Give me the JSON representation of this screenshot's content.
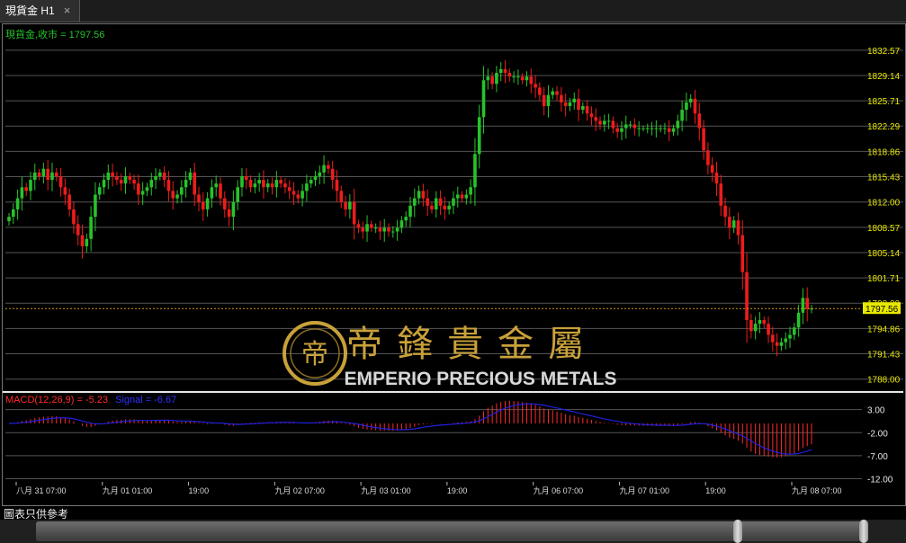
{
  "window": {
    "tab_title": "現貨金 H1",
    "close_glyph": "×"
  },
  "footer": {
    "note": "圖表只供參考"
  },
  "brand": {
    "chinese": "帝鋒貴金屬",
    "english": "EMPERIO PRECIOUS METALS",
    "logo_glyph": "帝"
  },
  "colors": {
    "up": "#27c32b",
    "down": "#ee1c1c",
    "grid": "#555555",
    "price_axis_text": "#e8e800",
    "current_price_line": "#d49a1a",
    "macd_hist": "#ff2a2a",
    "signal": "#2020e0",
    "gold": "#c9a13a"
  },
  "chart_data": [
    {
      "type": "candlestick",
      "label": "現貨金,收市 = 1797.56",
      "current_price": 1797.56,
      "current_price_label": "1797.56",
      "ylim": [
        1786.5,
        1834.5
      ],
      "y_ticks": [
        1832.57,
        1829.14,
        1825.71,
        1822.29,
        1818.86,
        1815.43,
        1812.0,
        1808.57,
        1805.14,
        1801.71,
        1798.29,
        1794.86,
        1791.43,
        1788.0
      ],
      "y_tick_labels": [
        "1832.57",
        "1829.14",
        "1825.71",
        "1822.29",
        "1818.86",
        "1815.43",
        "1812.00",
        "1808.57",
        "1805.14",
        "1801.71",
        "1798.29",
        "1794.86",
        "1791.43",
        "1788.00"
      ],
      "x_tick_labels": [
        "八月 31 07:00",
        "九月 01 01:00",
        "19:00",
        "九月 02 07:00",
        "九月 03 01:00",
        "19:00",
        "九月 06 07:00",
        "九月 07 01:00",
        "19:00",
        "九月 08 07:00"
      ],
      "close": [
        1810.0,
        1811.0,
        1812.5,
        1814.0,
        1813.5,
        1815.0,
        1816.0,
        1815.5,
        1816.5,
        1815.0,
        1816.0,
        1815.5,
        1814.0,
        1813.0,
        1811.0,
        1809.0,
        1807.5,
        1806.0,
        1807.0,
        1810.0,
        1813.0,
        1814.0,
        1815.0,
        1816.0,
        1815.5,
        1815.0,
        1814.5,
        1815.5,
        1815.0,
        1814.5,
        1813.0,
        1813.5,
        1814.0,
        1815.0,
        1815.5,
        1816.0,
        1815.0,
        1813.5,
        1812.5,
        1813.0,
        1814.0,
        1815.0,
        1816.0,
        1813.0,
        1812.0,
        1811.0,
        1812.5,
        1814.0,
        1814.5,
        1812.5,
        1811.0,
        1810.0,
        1812.0,
        1814.0,
        1815.5,
        1815.0,
        1814.0,
        1814.5,
        1815.0,
        1814.0,
        1814.5,
        1814.0,
        1815.0,
        1814.5,
        1814.0,
        1813.5,
        1813.0,
        1812.5,
        1813.5,
        1814.5,
        1815.0,
        1815.5,
        1816.0,
        1817.0,
        1816.5,
        1815.0,
        1813.5,
        1812.0,
        1811.0,
        1812.0,
        1809.0,
        1808.5,
        1808.0,
        1809.0,
        1808.5,
        1808.5,
        1808.0,
        1808.5,
        1808.0,
        1808.0,
        1808.5,
        1809.5,
        1810.0,
        1811.5,
        1812.5,
        1813.5,
        1812.5,
        1811.5,
        1811.0,
        1812.5,
        1811.5,
        1811.0,
        1811.5,
        1812.5,
        1813.0,
        1812.5,
        1813.0,
        1814.0,
        1818.5,
        1823.5,
        1828.5,
        1829.0,
        1828.0,
        1829.5,
        1830.0,
        1829.5,
        1829.0,
        1829.0,
        1829.0,
        1828.5,
        1829.0,
        1828.0,
        1827.5,
        1826.5,
        1825.0,
        1826.5,
        1827.0,
        1826.5,
        1825.5,
        1825.0,
        1825.5,
        1826.0,
        1824.5,
        1825.0,
        1824.0,
        1823.5,
        1823.0,
        1822.5,
        1823.0,
        1823.0,
        1822.0,
        1821.5,
        1822.0,
        1822.5,
        1822.5,
        1822.0,
        1822.0,
        1822.0,
        1822.0,
        1822.0,
        1822.0,
        1822.0,
        1822.0,
        1821.5,
        1822.0,
        1823.0,
        1824.5,
        1825.5,
        1826.0,
        1824.0,
        1822.0,
        1819.0,
        1817.0,
        1816.0,
        1814.5,
        1811.5,
        1810.0,
        1808.5,
        1809.5,
        1807.5,
        1802.5,
        1796.0,
        1794.5,
        1795.5,
        1796.0,
        1795.5,
        1794.0,
        1793.0,
        1792.5,
        1793.0,
        1793.5,
        1794.0,
        1795.0,
        1797.0,
        1799.0,
        1797.5,
        1797.56
      ]
    },
    {
      "type": "macd",
      "label": "MACD(12,26,9) = -5.23",
      "signal_label": "Signal = -6.67",
      "macd_value": -5.23,
      "signal_value": -6.67,
      "ylim": [
        -12.5,
        4.5
      ],
      "y_tick_labels": [
        "3.00",
        "-2.00",
        "-7.00",
        "-12.00"
      ],
      "y_ticks": [
        3.0,
        -2.0,
        -7.0,
        -12.0
      ]
    }
  ]
}
